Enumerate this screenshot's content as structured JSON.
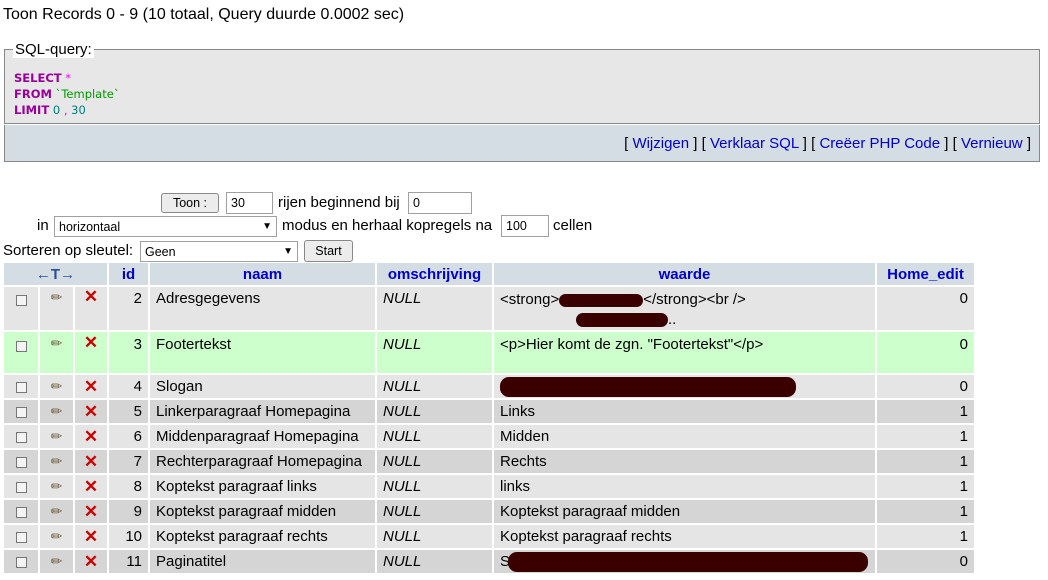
{
  "notice": "Toon Records 0 - 9 (10 totaal, Query duurde 0.0002 sec)",
  "sql": {
    "legend": "SQL-query:",
    "select_kw": "SELECT",
    "select_star": "*",
    "from_kw": "FROM",
    "table": "`Template`",
    "limit_kw": "LIMIT",
    "limit_start": "0",
    "limit_comma": ",",
    "limit_count": "30"
  },
  "links": {
    "wijzigen": "Wijzigen",
    "verklaar": "Verklaar SQL",
    "php": "Creëer PHP Code",
    "vernieuw": "Vernieuw"
  },
  "nav": {
    "toon_button": "Toon :",
    "rows_value": "30",
    "rijen_label": "rijen beginnend bij",
    "start_value": "0",
    "in_label": "in",
    "mode_value": "horizontaal",
    "modus_label": "modus en herhaal kopregels na",
    "repeat_value": "100",
    "cellen_label": "cellen",
    "sort_label": "Sorteren op sleutel:",
    "sort_value": "Geen",
    "start_button": "Start"
  },
  "table": {
    "arrows": "←T→",
    "headers": {
      "id": "id",
      "naam": "naam",
      "omschrijving": "omschrijving",
      "waarde": "waarde",
      "home_edit": "Home_edit"
    },
    "rows": [
      {
        "id": "2",
        "naam": "Adresgegevens",
        "omschrijving": "NULL",
        "waarde_a": "<strong>",
        "waarde_b": "</strong><br />",
        "waarde_c": "..",
        "home_edit": "0"
      },
      {
        "id": "3",
        "naam": "Footertekst",
        "omschrijving": "NULL",
        "waarde": "<p>Hier komt de zgn. \"Footertekst\"</p>",
        "home_edit": "0"
      },
      {
        "id": "4",
        "naam": "Slogan",
        "omschrijving": "NULL",
        "waarde": "",
        "home_edit": "0"
      },
      {
        "id": "5",
        "naam": "Linkerparagraaf Homepagina",
        "omschrijving": "NULL",
        "waarde": "Links",
        "home_edit": "1"
      },
      {
        "id": "6",
        "naam": "Middenparagraaf Homepagina",
        "omschrijving": "NULL",
        "waarde": "Midden",
        "home_edit": "1"
      },
      {
        "id": "7",
        "naam": "Rechterparagraaf Homepagina",
        "omschrijving": "NULL",
        "waarde": "Rechts",
        "home_edit": "1"
      },
      {
        "id": "8",
        "naam": "Koptekst paragraaf links",
        "omschrijving": "NULL",
        "waarde": "links",
        "home_edit": "1"
      },
      {
        "id": "9",
        "naam": "Koptekst paragraaf midden",
        "omschrijving": "NULL",
        "waarde": "Koptekst paragraaf midden",
        "home_edit": "1"
      },
      {
        "id": "10",
        "naam": "Koptekst paragraaf rechts",
        "omschrijving": "NULL",
        "waarde": "Koptekst paragraaf rechts",
        "home_edit": "1"
      },
      {
        "id": "11",
        "naam": "Paginatitel",
        "omschrijving": "NULL",
        "waarde": "S",
        "home_edit": "0"
      }
    ]
  }
}
